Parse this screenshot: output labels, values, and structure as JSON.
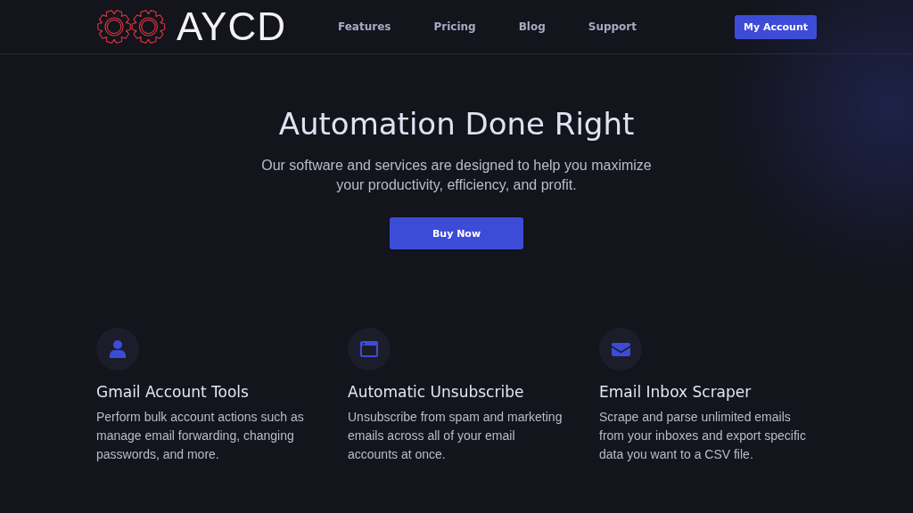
{
  "header": {
    "logo_text": "AYCD",
    "nav": [
      "Features",
      "Pricing",
      "Blog",
      "Support"
    ],
    "account_button": "My Account"
  },
  "hero": {
    "title": "Automation Done Right",
    "subtitle": "Our software and services are designed to help you maximize your productivity, efficiency, and profit.",
    "button": "Buy Now"
  },
  "features": [
    {
      "kind": "user",
      "title": "Gmail Account Tools",
      "text": "Perform bulk account actions such as manage email forwarding, changing passwords, and more."
    },
    {
      "kind": "window",
      "title": "Automatic Unsubscribe",
      "text": "Unsubscribe from spam and marketing emails across all of your email accounts at once."
    },
    {
      "kind": "envelope",
      "title": "Email Inbox Scraper",
      "text": "Scrape and parse unlimited emails from your inboxes and export specific data you want to a CSV file."
    }
  ]
}
